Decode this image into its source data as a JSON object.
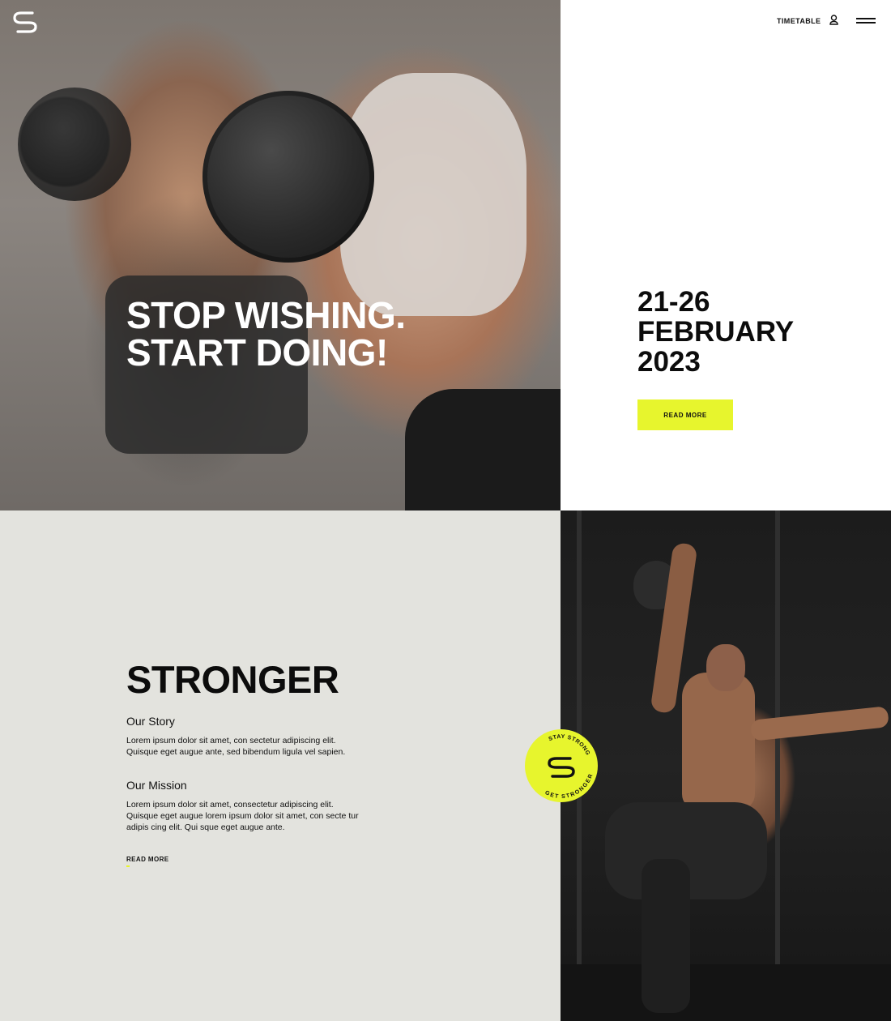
{
  "header": {
    "nav_timetable": "TIMETABLE",
    "icons": {
      "logo": "brand-s-logo-icon",
      "user": "user-icon",
      "menu": "hamburger-menu-icon"
    }
  },
  "hero": {
    "headline_line1": "STOP WISHING.",
    "headline_line2": "START DOING!"
  },
  "event": {
    "date_line1": "21-26",
    "date_line2": "FEBRUARY",
    "date_line3": "2023",
    "button_label": "READ MORE"
  },
  "story": {
    "title": "STRONGER",
    "our_story_heading": "Our Story",
    "our_story_text": "Lorem ipsum dolor sit amet, con sectetur adipiscing elit. Quisque eget augue ante, sed bibendum ligula vel sapien.",
    "our_mission_heading": "Our Mission",
    "our_mission_text": "Lorem ipsum dolor sit amet, consectetur adipiscing elit. Quisque eget augue lorem ipsum dolor sit amet, con secte tur adipis cing elit. Qui sque eget augue ante.",
    "read_more_label": "READ MORE"
  },
  "badge": {
    "top_text": "STAY STRONG",
    "bottom_text": "GET STRONGER",
    "separator": "•"
  },
  "colors": {
    "accent_yellow": "#e7f52d",
    "story_bg": "#e3e3de",
    "text_dark": "#0c0c0c"
  }
}
